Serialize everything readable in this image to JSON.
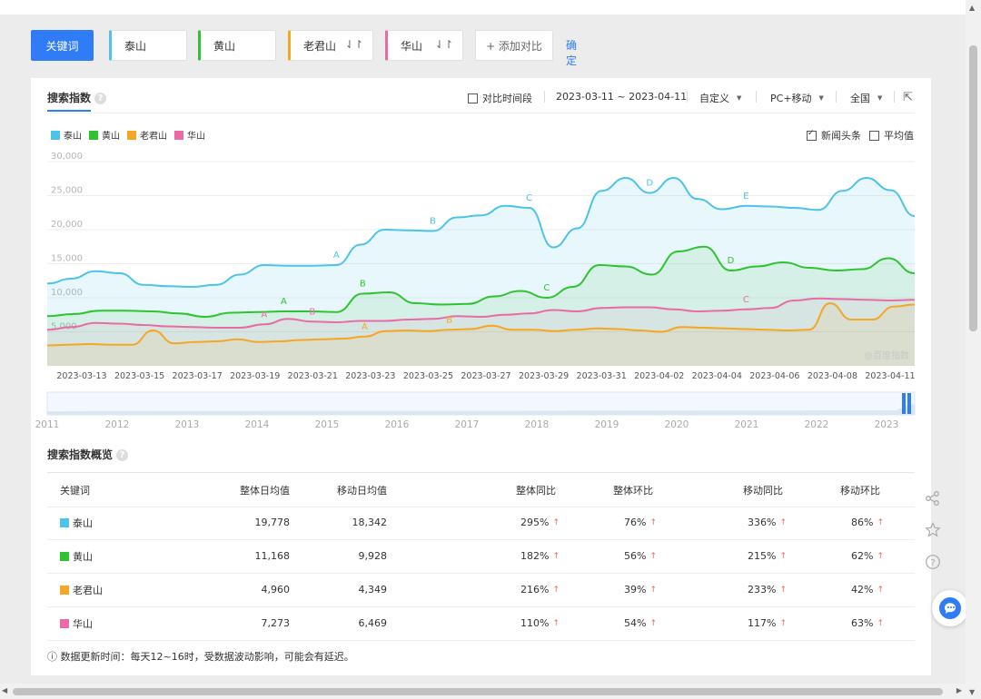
{
  "keywords_bar": {
    "main_label": "关键词",
    "items": [
      {
        "label": "泰山",
        "color": "#4cc3ea",
        "sortable": false
      },
      {
        "label": "黄山",
        "color": "#2fc42f",
        "sortable": false
      },
      {
        "label": "老君山",
        "color": "#f5a623",
        "sortable": true
      },
      {
        "label": "华山",
        "color": "#ea6aa6",
        "sortable": true
      }
    ],
    "add_label": "+ 添加对比",
    "confirm_label": "确定"
  },
  "panel": {
    "tab_label": "搜索指数",
    "compare_label": "对比时间段",
    "date_range": "2023-03-11 ~ 2023-04-11",
    "custom_label": "自定义",
    "device_label": "PC+移动",
    "region_label": "全国",
    "news_label": "新闻头条",
    "avg_label": "平均值"
  },
  "chart_data": {
    "type": "area",
    "watermark": "@百度指数",
    "x_ticks": [
      "2023-03-13",
      "2023-03-15",
      "2023-03-17",
      "2023-03-19",
      "2023-03-21",
      "2023-03-23",
      "2023-03-25",
      "2023-03-27",
      "2023-03-29",
      "2023-03-31",
      "2023-04-02",
      "2023-04-04",
      "2023-04-06",
      "2023-04-08",
      "2023-04-11"
    ],
    "y_ticks": [
      "30,000",
      "25,000",
      "20,000",
      "15,000",
      "10,000",
      "5,000"
    ],
    "ylim": [
      0,
      30000
    ],
    "x_dates": [
      "03-11",
      "03-12",
      "03-13",
      "03-14",
      "03-15",
      "03-16",
      "03-17",
      "03-18",
      "03-19",
      "03-20",
      "03-21",
      "03-22",
      "03-23",
      "03-24",
      "03-25",
      "03-26",
      "03-27",
      "03-28",
      "03-29",
      "03-30",
      "03-31",
      "04-01",
      "04-02",
      "04-03",
      "04-04",
      "04-05",
      "04-06",
      "04-07",
      "04-08",
      "04-09",
      "04-10",
      "04-11"
    ],
    "series": [
      {
        "name": "泰山",
        "color": "#4cc3ea",
        "values": [
          12100,
          12800,
          13900,
          13600,
          11900,
          11700,
          11600,
          11900,
          13400,
          14800,
          14700,
          14700,
          14800,
          17800,
          20000,
          19900,
          19800,
          21800,
          22100,
          23500,
          23200,
          17400,
          20200,
          25700,
          27600,
          25400,
          27600,
          24500,
          23000,
          23500,
          23400,
          23200,
          22900,
          25700,
          27600,
          25800,
          22000
        ]
      },
      {
        "name": "黄山",
        "color": "#2fc42f",
        "values": [
          7300,
          7600,
          8100,
          8100,
          8000,
          7700,
          7200,
          7800,
          7900,
          8000,
          8000,
          7900,
          10600,
          10800,
          9200,
          9000,
          9100,
          10200,
          11000,
          10000,
          11600,
          14800,
          14600,
          13400,
          16800,
          17500,
          14000,
          14600,
          15200,
          14400,
          14000,
          14200,
          15800,
          13600
        ]
      },
      {
        "name": "老君山",
        "color": "#f5a623",
        "values": [
          3000,
          3100,
          3200,
          3100,
          3100,
          5200,
          3300,
          3500,
          3600,
          3900,
          3500,
          3600,
          3800,
          3900,
          4000,
          4300,
          5100,
          5200,
          5100,
          5300,
          5400,
          5900,
          5300,
          5300,
          5100,
          5300,
          5500,
          5400,
          5200,
          5000,
          5700,
          5600,
          5500,
          5400,
          5300,
          5200,
          5300,
          9200,
          6800,
          6800,
          8700,
          9000
        ]
      },
      {
        "name": "华山",
        "color": "#ea6aa6",
        "values": [
          5300,
          5700,
          6300,
          6200,
          6000,
          5800,
          5700,
          5600,
          5600,
          6100,
          6900,
          6500,
          6400,
          6600,
          6600,
          6800,
          6900,
          7300,
          7200,
          7500,
          7700,
          8200,
          8000,
          8500,
          8600,
          8600,
          8300,
          8000,
          8100,
          8300,
          8500,
          9600,
          9900,
          9800,
          9700,
          9600,
          9700
        ]
      }
    ],
    "annotations": [
      {
        "label": "A",
        "series": "泰山",
        "x_index": 12
      },
      {
        "label": "B",
        "series": "泰山",
        "x_index": 16
      },
      {
        "label": "C",
        "series": "泰山",
        "x_index": 20
      },
      {
        "label": "D",
        "series": "泰山",
        "x_index": 25
      },
      {
        "label": "E",
        "series": "泰山",
        "x_index": 29
      },
      {
        "label": "A",
        "series": "黄山",
        "x_index": 9
      },
      {
        "label": "B",
        "series": "黄山",
        "x_index": 12
      },
      {
        "label": "C",
        "series": "黄山",
        "x_index": 19
      },
      {
        "label": "D",
        "series": "黄山",
        "x_index": 26
      },
      {
        "label": "A",
        "series": "华山",
        "x_index": 9
      },
      {
        "label": "B",
        "series": "华山",
        "x_index": 11
      },
      {
        "label": "C",
        "series": "华山",
        "x_index": 29
      },
      {
        "label": "A",
        "series": "老君山",
        "x_index": 15
      },
      {
        "label": "B",
        "series": "老君山",
        "x_index": 19
      }
    ],
    "navigator_years": [
      "2011",
      "2012",
      "2013",
      "2014",
      "2015",
      "2016",
      "2017",
      "2018",
      "2019",
      "2020",
      "2021",
      "2022",
      "2023"
    ]
  },
  "summary": {
    "title": "搜索指数概览",
    "headers": [
      "关键词",
      "整体日均值",
      "移动日均值",
      "整体同比",
      "整体环比",
      "移动同比",
      "移动环比"
    ],
    "rows": [
      {
        "keyword": "泰山",
        "color": "#4cc3ea",
        "overall_avg": "19,778",
        "mobile_avg": "18,342",
        "overall_yoy": "295%",
        "overall_mom": "76%",
        "mobile_yoy": "336%",
        "mobile_mom": "86%"
      },
      {
        "keyword": "黄山",
        "color": "#2fc42f",
        "overall_avg": "11,168",
        "mobile_avg": "9,928",
        "overall_yoy": "182%",
        "overall_mom": "56%",
        "mobile_yoy": "215%",
        "mobile_mom": "62%"
      },
      {
        "keyword": "老君山",
        "color": "#f5a623",
        "overall_avg": "4,960",
        "mobile_avg": "4,349",
        "overall_yoy": "216%",
        "overall_mom": "39%",
        "mobile_yoy": "233%",
        "mobile_mom": "42%"
      },
      {
        "keyword": "华山",
        "color": "#ea6aa6",
        "overall_avg": "7,273",
        "mobile_avg": "6,469",
        "overall_yoy": "110%",
        "overall_mom": "54%",
        "mobile_yoy": "117%",
        "mobile_mom": "63%"
      }
    ],
    "footnote": "ⓘ 数据更新时间：每天12~16时，受数据波动影响，可能会有延迟。"
  }
}
